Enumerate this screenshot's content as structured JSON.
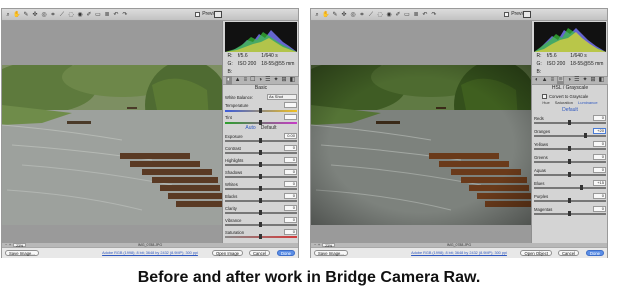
{
  "caption": "Before and after work in Bridge Camera Raw.",
  "colors": {
    "primary_button": "#5b8ee6",
    "panel_bg": "#c9c9c9",
    "link": "#2f58c0"
  },
  "toolbar": {
    "tools": [
      "zoom-icon",
      "hand-icon",
      "eyedropper-icon",
      "color-sampler-icon",
      "target-adjust-icon",
      "crop-icon",
      "straighten-icon",
      "spot-removal-icon",
      "red-eye-icon",
      "adjustment-brush-icon",
      "graduated-filter-icon",
      "preferences-icon",
      "rotate-ccw-icon",
      "rotate-cw-icon"
    ],
    "tool_glyphs": [
      "⌕",
      "✋",
      "✎",
      "✜",
      "◎",
      "⌗",
      "⟋",
      "◌",
      "◉",
      "✐",
      "▭",
      "≣",
      "↶",
      "↷"
    ],
    "preview_label": "Preview"
  },
  "before": {
    "readout": {
      "left": [
        "R:",
        "G:",
        "B:"
      ],
      "right": [
        "f/5.6",
        "1/640 s",
        "ISO 200",
        "18-55@55 mm"
      ]
    },
    "tabs": [
      "◐",
      "▲",
      "≡",
      "☐",
      "◑",
      "☰",
      "✦",
      "⊞",
      "◧"
    ],
    "section_title": "Basic",
    "white_balance": {
      "label": "White Balance:",
      "value": "As Shot"
    },
    "rows_top": [
      {
        "label": "Temperature",
        "value": "",
        "slider": "temp"
      },
      {
        "label": "Tint",
        "value": "",
        "slider": "tint"
      }
    ],
    "auto_label": "Auto",
    "default_label": "Default",
    "rows": [
      {
        "label": "Exposure",
        "value": "0.00"
      },
      {
        "label": "Contrast",
        "value": "0"
      },
      {
        "label": "Highlights",
        "value": "0"
      },
      {
        "label": "Shadows",
        "value": "0"
      },
      {
        "label": "Whites",
        "value": "0"
      },
      {
        "label": "Blacks",
        "value": "0"
      },
      {
        "label": "Clarity",
        "value": "0"
      },
      {
        "label": "Vibrance",
        "value": "0"
      },
      {
        "label": "Saturation",
        "value": "0"
      }
    ],
    "zoom_value": "23%",
    "filename": "IMG_0788.JPG",
    "buttons": {
      "save": "Save Image...",
      "open": "Open Image",
      "cancel": "Cancel",
      "done": "Done"
    },
    "workflow": "Adobe RGB (1998); 8 bit; 3648 by 2432 (8.9MP); 300 ppi"
  },
  "after": {
    "readout": {
      "left": [
        "R:",
        "G:",
        "B:"
      ],
      "right": [
        "f/5.6",
        "1/640 s",
        "ISO 200",
        "18-55@55 mm"
      ]
    },
    "tabs": [
      "◐",
      "▲",
      "≡",
      "☐",
      "◑",
      "☰",
      "✦",
      "⊞",
      "◧"
    ],
    "section_title": "HSL / Grayscale",
    "convert_label": "Convert to Grayscale",
    "hsl_tabs": [
      "Hue",
      "Saturation",
      "Luminance"
    ],
    "default_label": "Default",
    "rows": [
      {
        "label": "Reds",
        "value": "0"
      },
      {
        "label": "Oranges",
        "value": "+20",
        "selected": true
      },
      {
        "label": "Yellows",
        "value": "0"
      },
      {
        "label": "Greens",
        "value": "0"
      },
      {
        "label": "Aquas",
        "value": "0"
      },
      {
        "label": "Blues",
        "value": "+15"
      },
      {
        "label": "Purples",
        "value": "0"
      },
      {
        "label": "Magentas",
        "value": "0"
      }
    ],
    "zoom_value": "23%",
    "filename": "IMG_0788.JPG",
    "buttons": {
      "save": "Save Image...",
      "open": "Open Object",
      "cancel": "Cancel",
      "done": "Done"
    },
    "workflow": "Adobe RGB (1998); 8 bit; 3648 by 2432 (8.9MP); 300 ppi"
  }
}
